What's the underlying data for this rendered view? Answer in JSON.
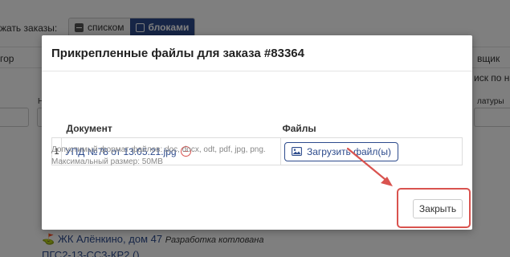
{
  "background": {
    "show_label": "жать заказы:",
    "view_list": "списком",
    "view_blocks": "блоками",
    "col_left": "гор",
    "col_right": "вщик",
    "search_right": "иск по на",
    "col_right2": "латуры",
    "item_title": "ЖК Алёнкино, дом 47",
    "item_stage": "Разработка котлована",
    "item_code": "ПГС2-13-СС3-КР2 ()",
    "left_mark": "Н"
  },
  "modal": {
    "title": "Прикрепленные файлы для заказа #83364",
    "table": {
      "headers": [
        "Документ",
        "Файлы"
      ],
      "rows": [
        {
          "num": "1",
          "document": "УПД №78 от 13.05.21.jpg",
          "upload_label": "Загрузить файл(ы)"
        }
      ]
    },
    "hint_formats": "Допустимый формат файлов: doc, docx, odt, pdf, jpg, png.",
    "hint_size": "Максимальный размер: 50MB",
    "close_label": "Закрыть"
  },
  "colors": {
    "accent": "#2d4b8c",
    "highlight": "#d9534f"
  }
}
